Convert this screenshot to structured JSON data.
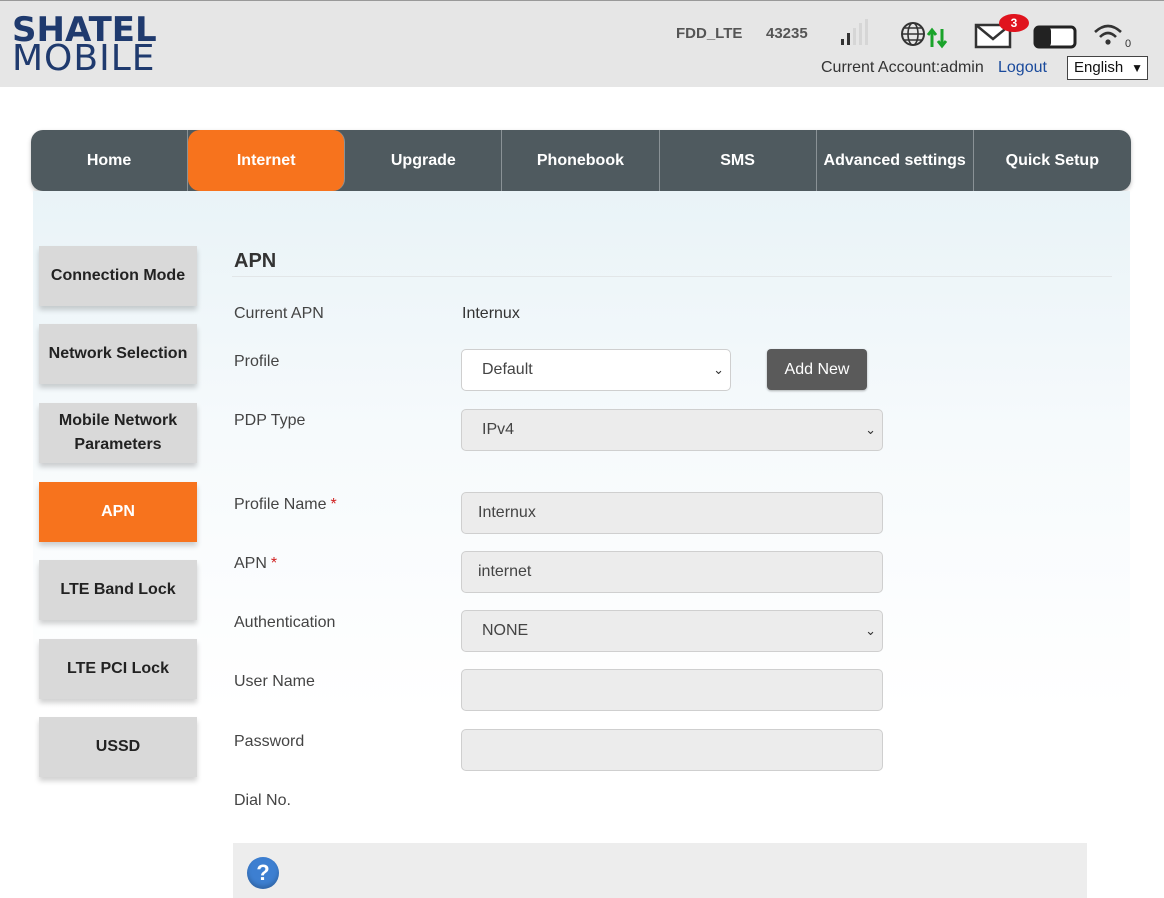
{
  "header": {
    "logo_line1": "SHATEL",
    "logo_line2": "MOBILE",
    "network_mode": "FDD_LTE",
    "network_code": "43235",
    "unread_sms_count": "3",
    "wifi_clients": "0",
    "account_text": "Current Account:admin",
    "logout_label": "Logout",
    "language": "English"
  },
  "icons": {
    "signal": "signal-strength-icon",
    "globe": "globe-icon",
    "data": "data-transfer-icon",
    "mail": "mail-icon",
    "battery": "battery-icon",
    "wifi": "wifi-icon",
    "help": "help-icon"
  },
  "colors": {
    "accent": "#f7731d",
    "nav_bg": "#4f5a5f",
    "logo": "#1f3a6e",
    "badge": "#e0141e",
    "link": "#1a4a9c"
  },
  "main_nav": [
    {
      "label": "Home"
    },
    {
      "label": "Internet",
      "active": true
    },
    {
      "label": "Upgrade"
    },
    {
      "label": "Phonebook"
    },
    {
      "label": "SMS"
    },
    {
      "label": "Advanced settings"
    },
    {
      "label": "Quick Setup"
    }
  ],
  "side_nav": [
    {
      "label": "Connection Mode"
    },
    {
      "label": "Network Selection"
    },
    {
      "label": "Mobile Network Parameters"
    },
    {
      "label": "APN",
      "active": true
    },
    {
      "label": "LTE Band Lock"
    },
    {
      "label": "LTE PCI Lock"
    },
    {
      "label": "USSD"
    }
  ],
  "form": {
    "title": "APN",
    "current_apn_label": "Current APN",
    "current_apn_value": "Internux",
    "profile_label": "Profile",
    "profile_value": "Default",
    "add_new_label": "Add New",
    "pdp_type_label": "PDP Type",
    "pdp_type_value": "IPv4",
    "profile_name_label": "Profile Name",
    "profile_name_value": "Internux",
    "apn_label": "APN",
    "apn_value": "internet",
    "authentication_label": "Authentication",
    "authentication_value": "NONE",
    "username_label": "User Name",
    "username_value": "",
    "password_label": "Password",
    "password_value": "",
    "dial_no_label": "Dial No.",
    "required_mark": "*",
    "help_glyph": "?"
  }
}
